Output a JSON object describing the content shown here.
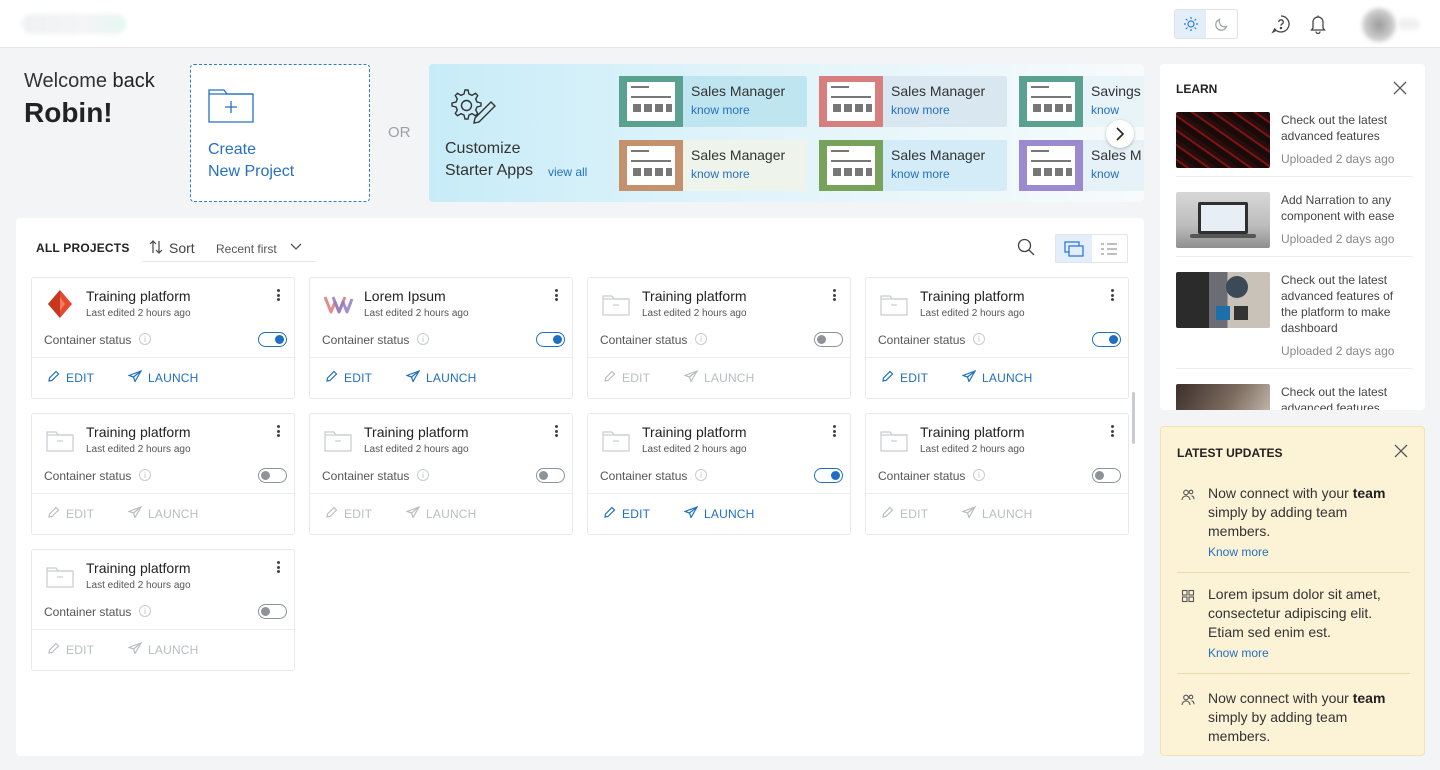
{
  "welcome": {
    "line1_a": "Welcome ",
    "line1_b": "back",
    "name": "Robin!"
  },
  "create": {
    "line1": "Create",
    "line2": "New Project"
  },
  "or_label": "OR",
  "starter": {
    "title_line1": "Customize",
    "title_line2": "Starter Apps",
    "view_all": "view all",
    "apps": [
      {
        "name": "Sales Manager",
        "link": "know more",
        "thumb_color": "#5aa18f",
        "bg": "#bfe6f0"
      },
      {
        "name": "Sales Manager",
        "link": "know more",
        "thumb_color": "#d77e7e",
        "bg": "#d9e7f0"
      },
      {
        "name": "Savings",
        "link": "know",
        "thumb_color": "#5aa18f",
        "bg": "#e8f4f7"
      },
      {
        "name": "Sales Manager",
        "link": "know more",
        "thumb_color": "#c4916c",
        "bg": "#eef4ec"
      },
      {
        "name": "Sales Manager",
        "link": "know more",
        "thumb_color": "#77a25a",
        "bg": "#d3ecf7"
      },
      {
        "name": "Sales M",
        "link": "know",
        "thumb_color": "#9c8ad0",
        "bg": "#e6f1f8"
      }
    ]
  },
  "projects": {
    "title": "ALL PROJECTS",
    "sort_label": "Sort",
    "sort_value": "Recent first",
    "items": [
      {
        "title": "Training platform",
        "edited": "Last edited 2 hours ago",
        "status_label": "Container status",
        "on": true,
        "icon": "diamond-logo",
        "edit": "EDIT",
        "launch": "LAUNCH"
      },
      {
        "title": "Lorem Ipsum",
        "edited": "Last edited 2 hours ago",
        "status_label": "Container status",
        "on": true,
        "icon": "w-logo",
        "edit": "EDIT",
        "launch": "LAUNCH"
      },
      {
        "title": "Training platform",
        "edited": "Last edited 2 hours ago",
        "status_label": "Container status",
        "on": false,
        "icon": "folder",
        "edit": "EDIT",
        "launch": "LAUNCH"
      },
      {
        "title": "Training platform",
        "edited": "Last edited 2 hours ago",
        "status_label": "Container status",
        "on": true,
        "icon": "folder",
        "edit": "EDIT",
        "launch": "LAUNCH"
      },
      {
        "title": "Training platform",
        "edited": "Last edited 2 hours ago",
        "status_label": "Container status",
        "on": false,
        "icon": "folder",
        "edit": "EDIT",
        "launch": "LAUNCH"
      },
      {
        "title": "Training platform",
        "edited": "Last edited 2 hours ago",
        "status_label": "Container status",
        "on": false,
        "icon": "folder",
        "edit": "EDIT",
        "launch": "LAUNCH"
      },
      {
        "title": "Training platform",
        "edited": "Last edited 2 hours ago",
        "status_label": "Container status",
        "on": true,
        "icon": "folder",
        "edit": "EDIT",
        "launch": "LAUNCH"
      },
      {
        "title": "Training platform",
        "edited": "Last edited 2 hours ago",
        "status_label": "Container status",
        "on": false,
        "icon": "folder",
        "edit": "EDIT",
        "launch": "LAUNCH"
      },
      {
        "title": "Training platform",
        "edited": "Last edited 2 hours ago",
        "status_label": "Container status",
        "on": false,
        "icon": "folder",
        "edit": "EDIT",
        "launch": "LAUNCH"
      }
    ]
  },
  "learn": {
    "title": "LEARN",
    "items": [
      {
        "text": "Check out the latest advanced features",
        "date": "Uploaded 2 days ago",
        "thumb": "keyboard-red"
      },
      {
        "text": "Add Narration to any component with ease",
        "date": "Uploaded 2 days ago",
        "thumb": "laptop"
      },
      {
        "text": "Check out the latest advanced features of the platform to make dashboard",
        "date": "Uploaded 2 days ago",
        "thumb": "desk"
      },
      {
        "text": "Check out the latest advanced features",
        "date": "",
        "thumb": "hands"
      }
    ]
  },
  "updates": {
    "title": "LATEST UPDATES",
    "items": [
      {
        "pre": "Now connect with your ",
        "bold": "team",
        "post": " simply by adding team members.",
        "link": "Know more",
        "icon": "users-icon"
      },
      {
        "pre": "Lorem ipsum dolor sit amet, consectetur adipiscing elit. Etiam sed enim est.",
        "bold": "",
        "post": "",
        "link": "Know more",
        "icon": "grid-icon"
      },
      {
        "pre": "Now connect with your ",
        "bold": "team",
        "post": " simply by adding team members.",
        "link": "",
        "icon": "users-icon"
      }
    ]
  },
  "colors": {
    "accent": "#1e6fc1",
    "link": "#2670c0",
    "updates_bg": "#fcf3d6",
    "disabled": "#b9bdc2"
  }
}
